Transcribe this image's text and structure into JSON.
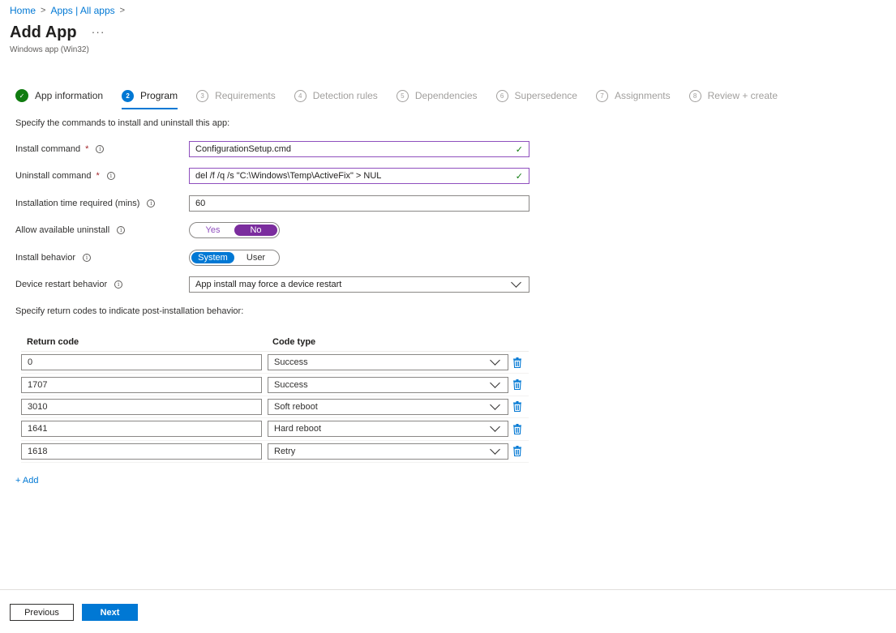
{
  "breadcrumb": {
    "home": "Home",
    "apps": "Apps | All apps",
    "sep": ">"
  },
  "header": {
    "title": "Add App",
    "more": "···",
    "subtitle": "Windows app (Win32)"
  },
  "wizard": {
    "steps": [
      {
        "num": "✓",
        "label": "App information",
        "state": "done"
      },
      {
        "num": "2",
        "label": "Program",
        "state": "current"
      },
      {
        "num": "3",
        "label": "Requirements",
        "state": "pending"
      },
      {
        "num": "4",
        "label": "Detection rules",
        "state": "pending"
      },
      {
        "num": "5",
        "label": "Dependencies",
        "state": "pending"
      },
      {
        "num": "6",
        "label": "Supersedence",
        "state": "pending"
      },
      {
        "num": "7",
        "label": "Assignments",
        "state": "pending"
      },
      {
        "num": "8",
        "label": "Review + create",
        "state": "pending"
      }
    ]
  },
  "form": {
    "instructions": "Specify the commands to install and uninstall this app:",
    "required_mark": "*",
    "info_glyph": "i",
    "install_command": {
      "label": "Install command",
      "value": "ConfigurationSetup.cmd"
    },
    "uninstall_command": {
      "label": "Uninstall command",
      "value": "del /f /q /s \"C:\\Windows\\Temp\\ActiveFix\" > NUL"
    },
    "install_time": {
      "label": "Installation time required (mins)",
      "value": "60"
    },
    "allow_uninstall": {
      "label": "Allow available uninstall",
      "yes": "Yes",
      "no": "No",
      "selected": "No"
    },
    "install_behavior": {
      "label": "Install behavior",
      "system": "System",
      "user": "User",
      "selected": "System"
    },
    "restart_behavior": {
      "label": "Device restart behavior",
      "value": "App install may force a device restart"
    }
  },
  "return_codes": {
    "instructions": "Specify return codes to indicate post-installation behavior:",
    "col_code": "Return code",
    "col_type": "Code type",
    "rows": [
      {
        "code": "0",
        "type": "Success"
      },
      {
        "code": "1707",
        "type": "Success"
      },
      {
        "code": "3010",
        "type": "Soft reboot"
      },
      {
        "code": "1641",
        "type": "Hard reboot"
      },
      {
        "code": "1618",
        "type": "Retry"
      }
    ],
    "add_label": "+ Add"
  },
  "footer": {
    "previous": "Previous",
    "next": "Next"
  },
  "colors": {
    "accent": "#0078d4",
    "success": "#107c10",
    "toggle_purple": "#7b2d9e",
    "valid_border": "#8f4fbe"
  },
  "icons": {
    "check": "check-icon",
    "info": "info-icon",
    "trash": "trash-icon",
    "chevron": "chevron-down-icon"
  }
}
